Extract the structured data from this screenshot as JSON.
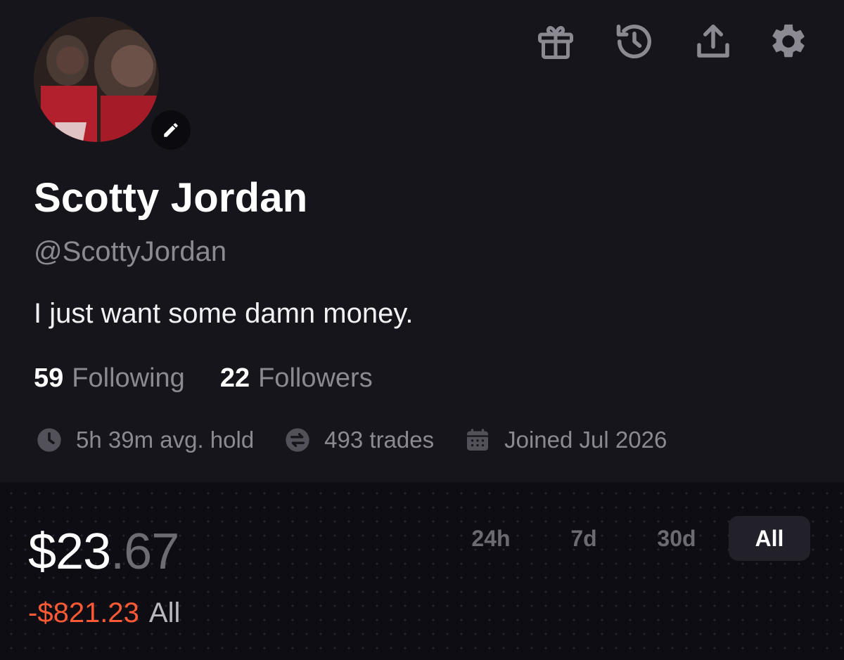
{
  "profile": {
    "display_name": "Scotty Jordan",
    "handle": "@ScottyJordan",
    "bio": "I just want some damn money.",
    "following_count": "59",
    "following_label": "Following",
    "followers_count": "22",
    "followers_label": "Followers",
    "avg_hold": "5h 39m avg. hold",
    "trades": "493 trades",
    "joined": "Joined Jul 2026"
  },
  "header_icons": [
    "gift-icon",
    "history-icon",
    "share-icon",
    "settings-icon"
  ],
  "portfolio": {
    "balance_whole": "$23",
    "balance_cents": ".67",
    "change_amount": "-$821.23",
    "change_period": "All",
    "ranges": [
      "24h",
      "7d",
      "30d",
      "All"
    ],
    "selected_range": "All"
  },
  "colors": {
    "background": "#16151c",
    "negative": "#ff5a36",
    "muted_text": "#8b8a93"
  }
}
